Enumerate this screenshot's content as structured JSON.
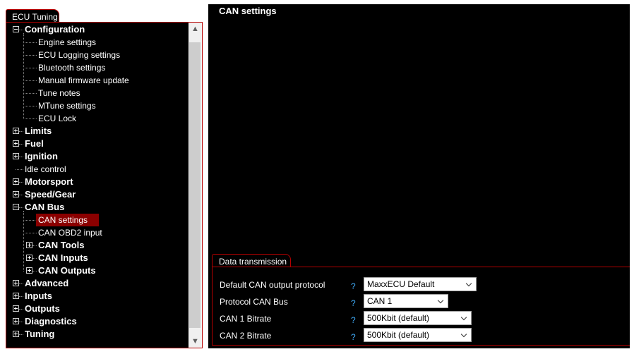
{
  "window": {
    "tab_label": "ECU Tuning"
  },
  "tree": [
    {
      "label": "Configuration",
      "level": 0,
      "bold": true,
      "expander": "minus"
    },
    {
      "label": "Engine settings",
      "level": 1,
      "bold": false,
      "expander": "none"
    },
    {
      "label": "ECU Logging settings",
      "level": 1,
      "bold": false,
      "expander": "none"
    },
    {
      "label": "Bluetooth settings",
      "level": 1,
      "bold": false,
      "expander": "none"
    },
    {
      "label": "Manual firmware update",
      "level": 1,
      "bold": false,
      "expander": "none"
    },
    {
      "label": "Tune notes",
      "level": 1,
      "bold": false,
      "expander": "none"
    },
    {
      "label": "MTune settings",
      "level": 1,
      "bold": false,
      "expander": "none"
    },
    {
      "label": "ECU Lock",
      "level": 1,
      "bold": false,
      "expander": "none"
    },
    {
      "label": "Limits",
      "level": 0,
      "bold": true,
      "expander": "plus"
    },
    {
      "label": "Fuel",
      "level": 0,
      "bold": true,
      "expander": "plus"
    },
    {
      "label": "Ignition",
      "level": 0,
      "bold": true,
      "expander": "plus"
    },
    {
      "label": "Idle control",
      "level": 0,
      "bold": false,
      "expander": "none"
    },
    {
      "label": "Motorsport",
      "level": 0,
      "bold": true,
      "expander": "plus"
    },
    {
      "label": "Speed/Gear",
      "level": 0,
      "bold": true,
      "expander": "plus"
    },
    {
      "label": "CAN Bus",
      "level": 0,
      "bold": true,
      "expander": "minus"
    },
    {
      "label": "CAN settings",
      "level": 1,
      "bold": false,
      "expander": "none",
      "selected": true
    },
    {
      "label": "CAN OBD2 input",
      "level": 1,
      "bold": false,
      "expander": "none"
    },
    {
      "label": "CAN Tools",
      "level": 1,
      "bold": true,
      "expander": "plus"
    },
    {
      "label": "CAN Inputs",
      "level": 1,
      "bold": true,
      "expander": "plus"
    },
    {
      "label": "CAN Outputs",
      "level": 1,
      "bold": true,
      "expander": "plus"
    },
    {
      "label": "Advanced",
      "level": 0,
      "bold": true,
      "expander": "plus"
    },
    {
      "label": "Inputs",
      "level": 0,
      "bold": true,
      "expander": "plus"
    },
    {
      "label": "Outputs",
      "level": 0,
      "bold": true,
      "expander": "plus"
    },
    {
      "label": "Diagnostics",
      "level": 0,
      "bold": true,
      "expander": "plus"
    },
    {
      "label": "Tuning",
      "level": 0,
      "bold": true,
      "expander": "plus"
    }
  ],
  "scrollbar": {
    "up_icon": "▲",
    "down_icon": "▼"
  },
  "main": {
    "title": "CAN settings",
    "section": {
      "title": "Data transmission",
      "rows": [
        {
          "label": "Default CAN output protocol",
          "help": "?",
          "value": "MaxxECU Default"
        },
        {
          "label": "Protocol CAN Bus",
          "help": "?",
          "value": "CAN 1"
        },
        {
          "label": "CAN 1 Bitrate",
          "help": "?",
          "value": "500Kbit (default)"
        },
        {
          "label": "CAN 2 Bitrate",
          "help": "?",
          "value": "500Kbit (default)"
        }
      ]
    }
  },
  "colors": {
    "accent_border": "#b50000",
    "selected_bg": "#8b0000",
    "help": "#3fa9f5"
  }
}
